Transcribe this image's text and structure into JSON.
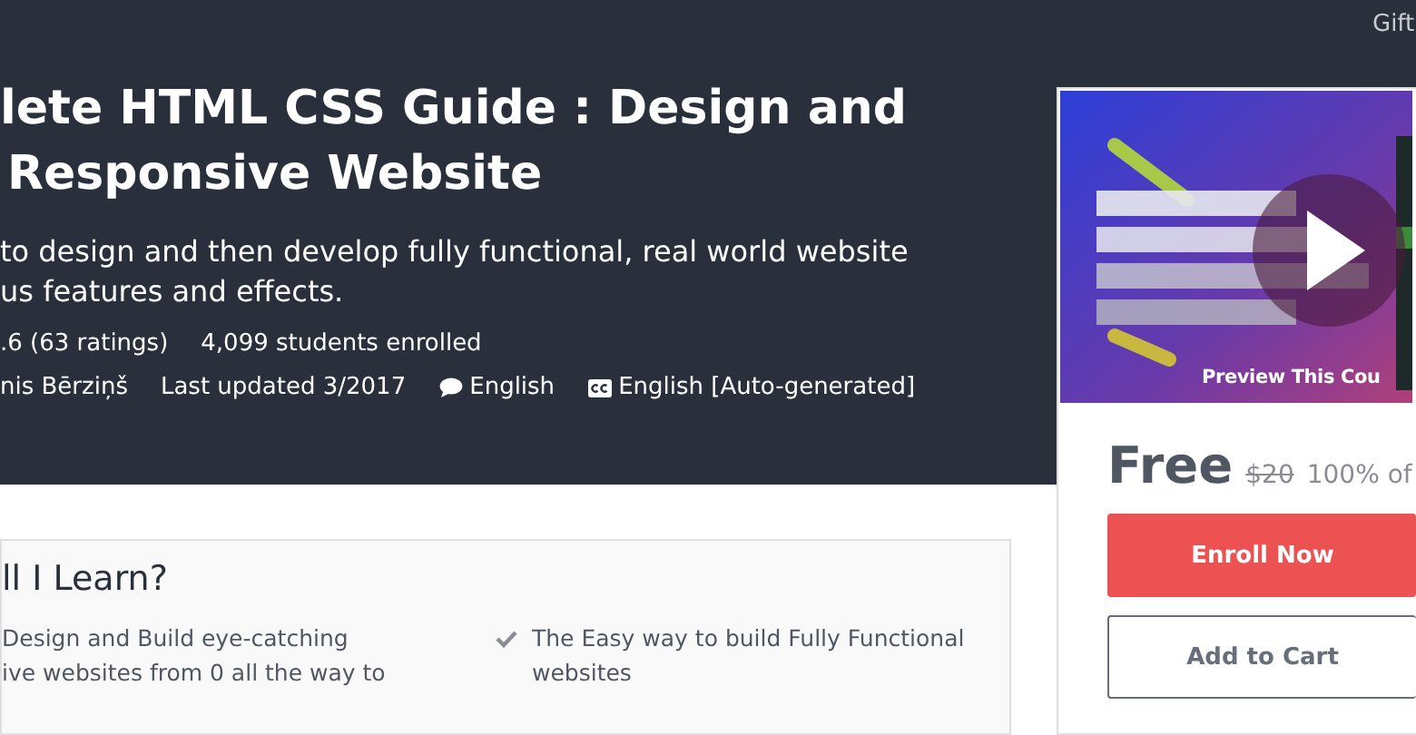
{
  "top_link": "Gift",
  "header": {
    "title_lines": [
      "lete HTML CSS Guide : Design and",
      "Responsive Website"
    ],
    "subtitle_lines": [
      "to design and then develop fully functional, real world website",
      "us features and effects."
    ],
    "rating": ".6 (63 ratings)",
    "students": "4,099 students enrolled",
    "author": "nis Bērziņš",
    "last_updated": "Last updated 3/2017",
    "language": "English",
    "captions": "English [Auto-generated]"
  },
  "learn": {
    "heading": "ll I Learn?",
    "items": [
      {
        "lines": [
          "Design and Build eye-catching",
          "ive websites from 0 all the way to"
        ]
      },
      {
        "lines": [
          "The Easy way to build Fully Functional",
          "websites"
        ]
      }
    ]
  },
  "card": {
    "preview_label": "Preview This Cou",
    "price": "Free",
    "original_price": "$20",
    "discount": "100% of",
    "buttons": [
      {
        "label": "Enroll Now",
        "kind": "primary"
      },
      {
        "label": "Add to Cart",
        "kind": "secondary"
      }
    ]
  }
}
